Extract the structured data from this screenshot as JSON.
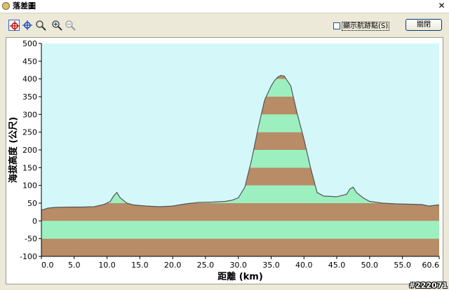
{
  "window": {
    "title": "落差圖",
    "close_glyph": "✕"
  },
  "toolbar": {
    "icons": [
      "crosshair-red-icon",
      "crosshair-blue-icon",
      "zoom-region-icon",
      "zoom-in-icon",
      "zoom-out-icon"
    ],
    "checkbox_label": "顯示航跡點(S)",
    "checkbox_checked": false,
    "close_button_label": "關閉"
  },
  "watermark": "#222071",
  "colors": {
    "sky": "#d4f8fa",
    "band_brown": "#b78c67",
    "band_green": "#9cf0c0",
    "profile_line": "#555555"
  },
  "chart_data": {
    "type": "area",
    "title": "",
    "xlabel": "距離  (km)",
    "ylabel": "海拔高度 (公尺)",
    "xlim": [
      0,
      60.6
    ],
    "ylim": [
      -100,
      500
    ],
    "xticks": [
      "0.0",
      "5.0",
      "10.0",
      "15.0",
      "20.0",
      "25.0",
      "30.0",
      "35.0",
      "40.0",
      "45.0",
      "50.0",
      "55.0",
      "60.6"
    ],
    "yticks": [
      "500",
      "450",
      "400",
      "350",
      "300",
      "250",
      "200",
      "150",
      "100",
      "50",
      "0",
      "-50",
      "-100"
    ],
    "band_height": 50,
    "x": [
      0,
      1,
      2,
      4,
      6,
      8,
      9.5,
      10.5,
      11,
      11.5,
      12,
      13,
      14,
      16,
      18,
      20,
      22,
      24,
      26,
      28,
      29,
      30,
      31,
      32,
      33,
      34,
      35,
      35.5,
      36,
      36.5,
      37,
      38,
      39,
      40,
      41,
      42,
      43,
      45,
      46.5,
      47,
      47.5,
      48,
      49,
      50,
      52,
      54,
      56,
      58,
      59,
      60,
      60.6
    ],
    "y": [
      30,
      36,
      38,
      39,
      39,
      40,
      46,
      55,
      70,
      80,
      65,
      50,
      45,
      42,
      40,
      42,
      48,
      52,
      53,
      55,
      58,
      65,
      95,
      170,
      260,
      340,
      380,
      395,
      405,
      410,
      408,
      380,
      300,
      230,
      150,
      80,
      70,
      68,
      75,
      90,
      95,
      80,
      65,
      55,
      50,
      48,
      47,
      46,
      42,
      44,
      45
    ]
  }
}
